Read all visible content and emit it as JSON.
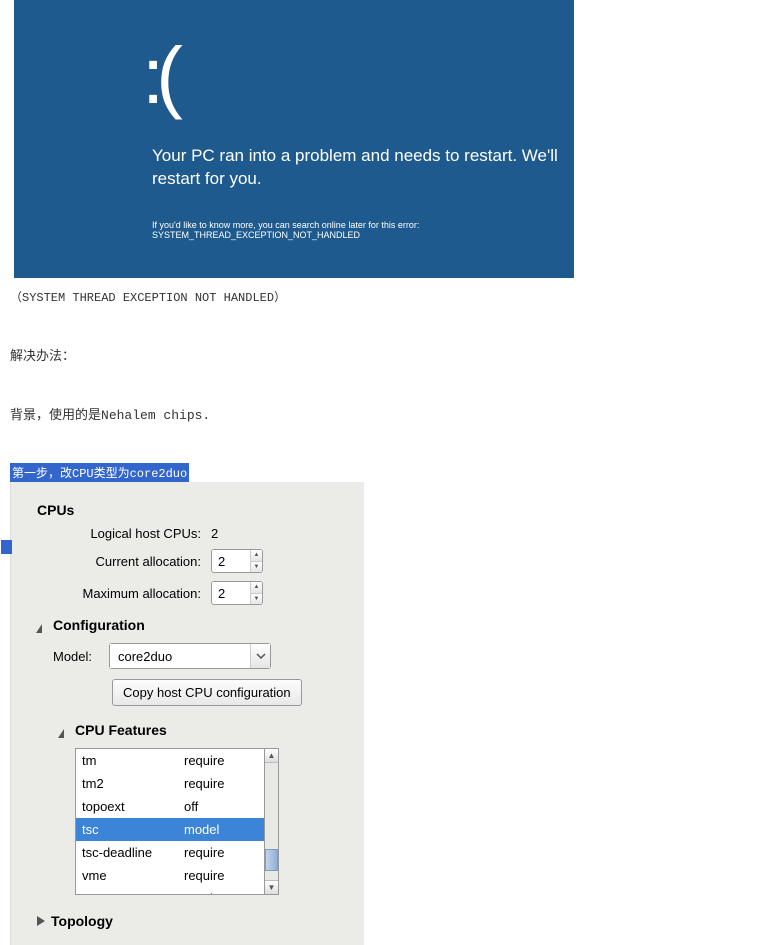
{
  "bsod": {
    "face": ":(",
    "message": "Your PC ran into a problem and needs to restart. We'll restart for you.",
    "detail": "If you'd like to know more, you can search online later for this error: SYSTEM_THREAD_EXCEPTION_NOT_HANDLED"
  },
  "caption": "（SYSTEM THREAD EXCEPTION NOT HANDLED）",
  "solution_label": "解决办法：",
  "background_prefix": "背景，使用的是",
  "background_chips": "Nehalem chips.",
  "step1": "第一步，改CPU类型为core2duo",
  "cpus": {
    "title": "CPUs",
    "logical_label": "Logical host CPUs:",
    "logical_value": "2",
    "current_label": "Current allocation:",
    "current_value": "2",
    "max_label": "Maximum allocation:",
    "max_value": "2"
  },
  "config": {
    "title": "Configuration",
    "model_label": "Model:",
    "model_value": "core2duo",
    "copy_btn": "Copy host CPU configuration"
  },
  "features": {
    "title": "CPU Features",
    "rows": [
      {
        "name": "tm",
        "value": "require"
      },
      {
        "name": "tm2",
        "value": "require"
      },
      {
        "name": "topoext",
        "value": "off"
      },
      {
        "name": "tsc",
        "value": "model"
      },
      {
        "name": "tsc-deadline",
        "value": "require"
      },
      {
        "name": "vme",
        "value": "require"
      },
      {
        "name": "vmx",
        "value": "require"
      }
    ],
    "selected_index": 3
  },
  "topology": {
    "title": "Topology"
  }
}
